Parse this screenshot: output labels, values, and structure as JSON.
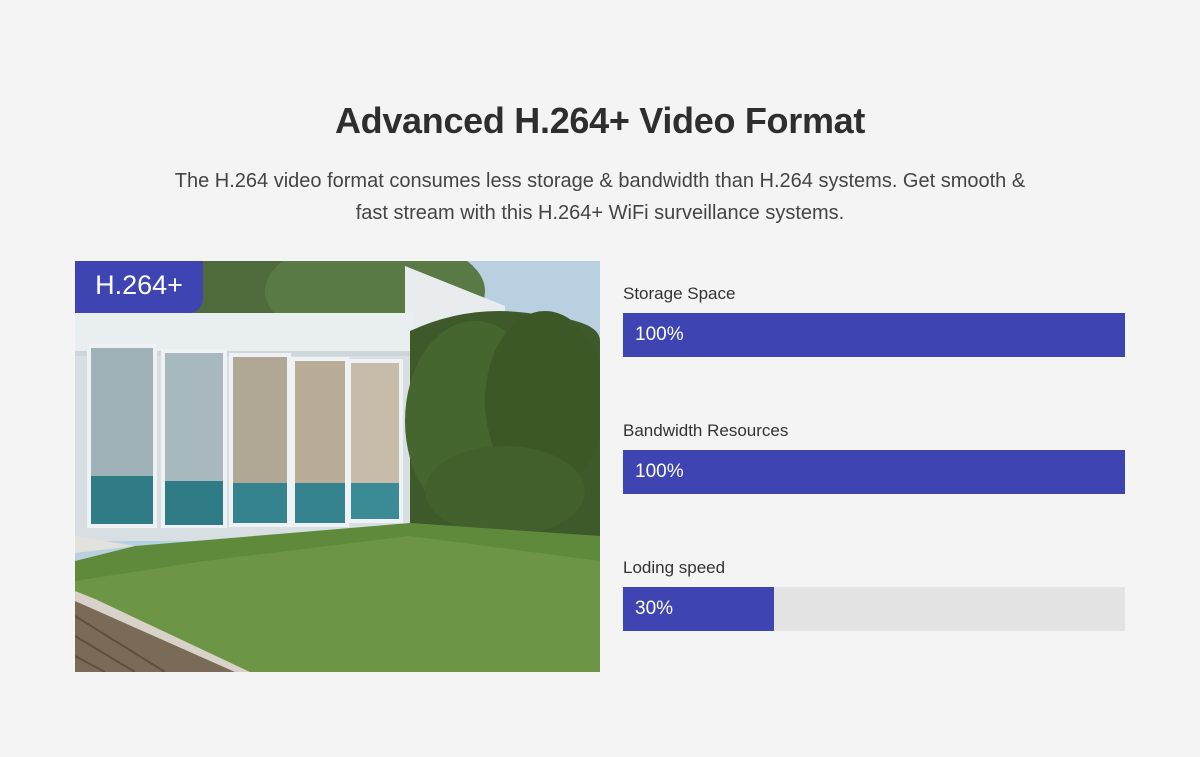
{
  "heading": {
    "title": "Advanced H.264+ Video Format",
    "description": "The H.264 video format consumes less storage & bandwidth than H.264 systems. Get smooth & fast stream with this H.264+ WiFi surveillance systems."
  },
  "image": {
    "badge": "H.264+"
  },
  "metrics": [
    {
      "label": "Storage Space",
      "value_text": "100%",
      "percent": 100
    },
    {
      "label": "Bandwidth Resources",
      "value_text": "100%",
      "percent": 100
    },
    {
      "label": "Loding speed",
      "value_text": "30%",
      "percent": 30
    }
  ],
  "colors": {
    "accent": "#3f44b3",
    "bar_track": "#e3e3e3",
    "background": "#f4f4f4"
  }
}
